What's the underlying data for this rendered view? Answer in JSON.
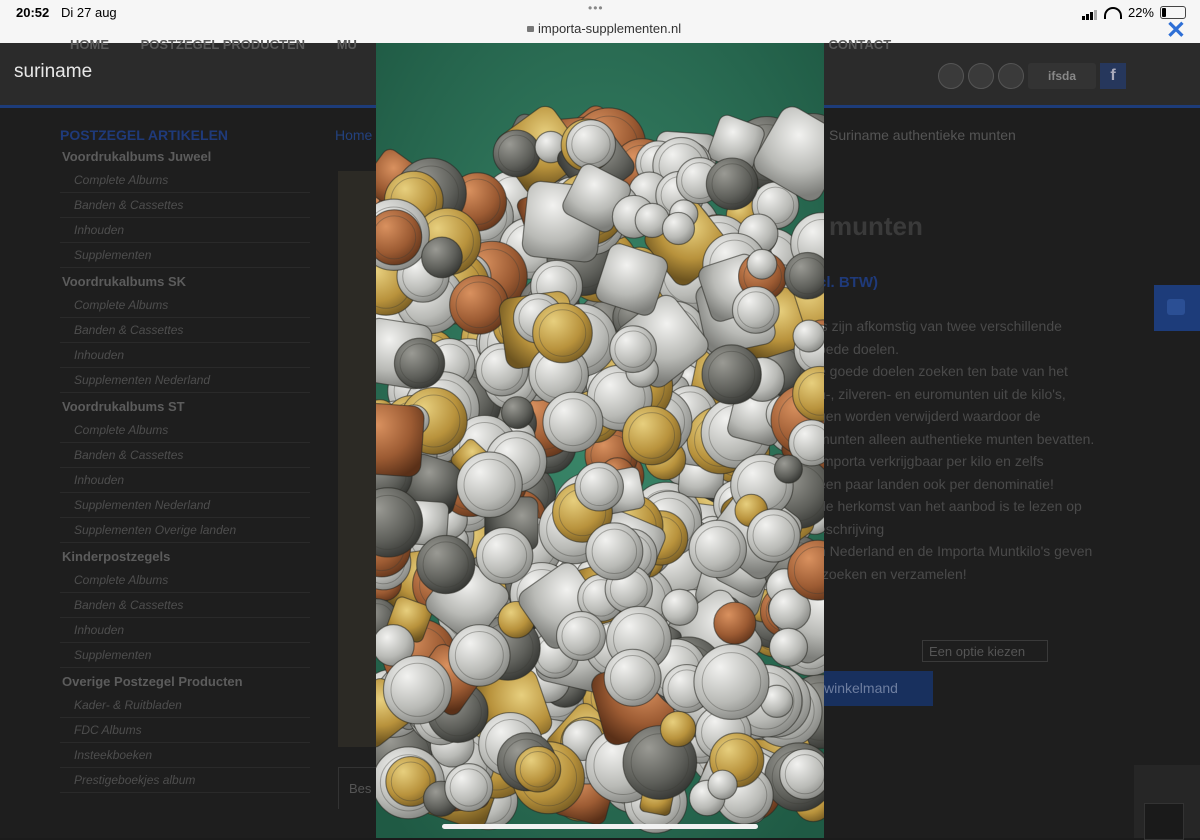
{
  "status_bar": {
    "time": "20:52",
    "date": "Di 27 aug",
    "url": "importa-supplementen.nl",
    "battery": "22%",
    "battery_level": 0.22
  },
  "site": {
    "brand": "suriname",
    "nav": [
      "HOME",
      "POSTZEGEL PRODUCTEN",
      "MU",
      "CONTACT"
    ],
    "logo_text": "ifsda",
    "facebook_glyph": "f",
    "sidebar": {
      "title": "POSTZEGEL ARTIKELEN",
      "groups": [
        {
          "label": "Voordrukalbums Juweel",
          "items": [
            "Complete Albums",
            "Banden & Cassettes",
            "Inhouden",
            "Supplementen"
          ]
        },
        {
          "label": "Voordrukalbums SK",
          "items": [
            "Complete Albums",
            "Banden & Cassettes",
            "Inhouden",
            "Supplementen Nederland"
          ]
        },
        {
          "label": "Voordrukalbums ST",
          "items": [
            "Complete Albums",
            "Banden & Cassettes",
            "Inhouden",
            "Supplementen Nederland",
            "Supplementen Overige landen"
          ]
        },
        {
          "label": "Kinderpostzegels",
          "items": [
            "Complete Albums",
            "Banden & Cassettes",
            "Inhouden",
            "Supplementen"
          ]
        },
        {
          "label": "Overige Postzegel Producten",
          "items": [
            "Kader- & Ruitbladen",
            "FDC Albums",
            "Insteekboeken",
            "Prestigeboekjes album"
          ]
        }
      ]
    },
    "breadcrumb_home": "Home",
    "breadcrumb_current": "Suriname authentieke munten",
    "product_title": "munten",
    "price_fragment": "cl. BTW)",
    "description_lines": [
      "'s zijn afkomstig van twee verschillende",
      "oede doelen.",
      "e goede doelen zoeken ten bate van het",
      "n-, zilveren- en euromunten uit de kilo's,",
      "gen worden verwijderd waardoor de",
      "munten alleen authentieke munten bevatten.",
      "Importa verkrijgbaar per kilo en zelfs",
      "een paar landen ook per denominatie!",
      "de herkomst van het aanbod is te lezen op",
      "eschrijving",
      "n Nederland en de Importa Muntkilo's geven",
      "tzoeken en verzamelen!"
    ],
    "select_placeholder": "Een optie kiezen",
    "cart_button": "winkelmand",
    "tab_label": "Bes"
  },
  "icons": {
    "close": "close-icon",
    "lock": "lock-icon",
    "scroll_top": "arrow-up-icon"
  }
}
